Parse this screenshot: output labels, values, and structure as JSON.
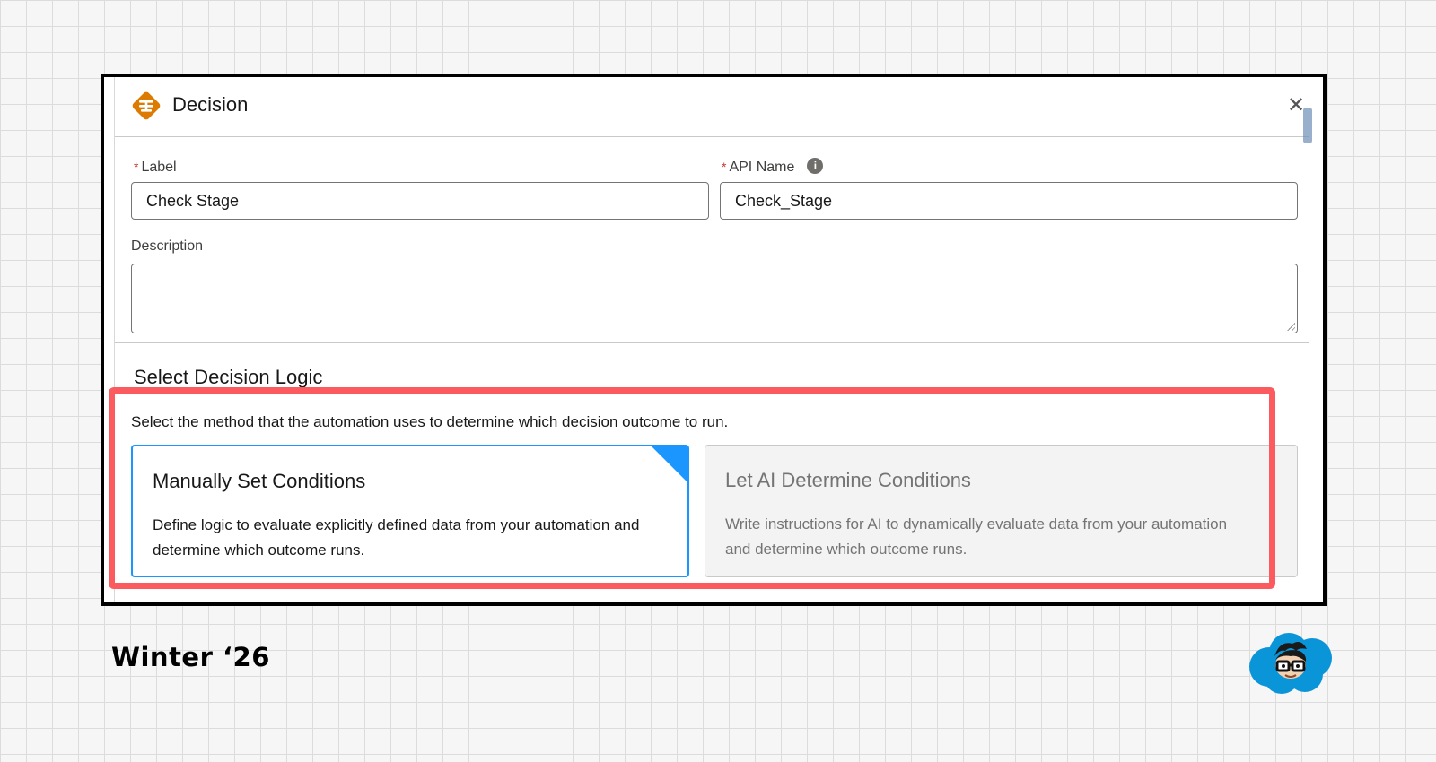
{
  "modal": {
    "title": "Decision",
    "close_symbol": "✕",
    "icon": "decision-icon"
  },
  "fields": {
    "label": {
      "required_mark": "*",
      "label": "Label",
      "value": "Check Stage"
    },
    "api_name": {
      "required_mark": "*",
      "label": "API Name",
      "value": "Check_Stage",
      "info_symbol": "i"
    },
    "description": {
      "label": "Description",
      "value": ""
    }
  },
  "decision_logic": {
    "title": "Select Decision Logic",
    "description": "Select the method that the automation uses to determine which decision outcome to run.",
    "options": [
      {
        "title": "Manually Set Conditions",
        "body": "Define logic to evaluate explicitly defined data from your automation and determine which outcome runs.",
        "selected": true
      },
      {
        "title": "Let AI Determine Conditions",
        "body": "Write instructions for AI to dynamically evaluate data from your automation and determine which outcome runs.",
        "selected": false
      }
    ]
  },
  "footer": {
    "release": "Winter ‘26",
    "logo": "salesforce-cloud-mascot-logo"
  },
  "colors": {
    "highlight": "#fb5a5f",
    "selected_border": "#1b96ff",
    "decision_icon": "#dd7a01",
    "required": "#c23934"
  }
}
